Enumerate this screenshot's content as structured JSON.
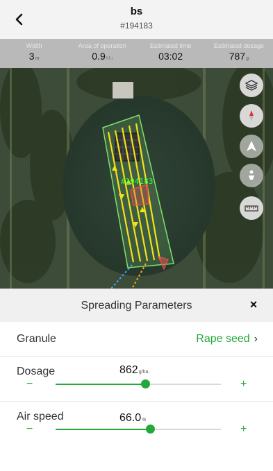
{
  "header": {
    "title": "bs",
    "subtitle": "#194183"
  },
  "stats": [
    {
      "label": "Width",
      "value": "3",
      "unit": "m"
    },
    {
      "label": "Area of operation",
      "value": "0.9",
      "unit": "Mu"
    },
    {
      "label": "Estimated time",
      "value": "03:02",
      "unit": ""
    },
    {
      "label": "Estimated dosage",
      "value": "787",
      "unit": "g"
    }
  ],
  "map": {
    "field_label": "#194183",
    "tools": [
      "layers-icon",
      "compass-icon",
      "navigate-icon",
      "person-location-icon",
      "ruler-icon"
    ]
  },
  "panel": {
    "title": "Spreading Parameters",
    "close": "×",
    "granule": {
      "label": "Granule",
      "value": "Rape seed",
      "chevron": "›"
    },
    "dosage": {
      "label": "Dosage",
      "value": "862",
      "unit": "g/ha.",
      "fraction": 0.54,
      "minus": "−",
      "plus": "+"
    },
    "air_speed": {
      "label": "Air speed",
      "value": "66.0",
      "unit": "%",
      "fraction": 0.57,
      "minus": "−",
      "plus": "+"
    }
  },
  "colors": {
    "accent": "#23a93a",
    "route": "#f2e21a",
    "field_border": "#7fe06a"
  }
}
